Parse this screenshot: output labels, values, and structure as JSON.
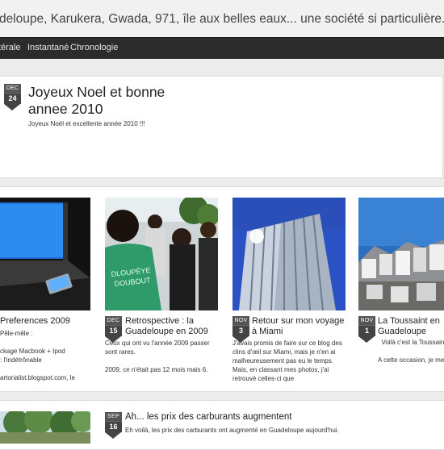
{
  "header": {
    "title": "deloupe, Karukera, Gwada, 971, île aux belles eaux... une société si particulière..."
  },
  "nav": [
    "térale",
    "Instantané",
    "Chronologie"
  ],
  "main_post": {
    "month": "DEC",
    "day": "24",
    "title": "Joyeux Noel et bonne annee 2010",
    "text": "Joyeux Noël et excellente année 2010 !!!"
  },
  "cards": [
    {
      "title": "Preferences 2009",
      "text": "Pêle-mêle :\n\nckage Macbook + Ipod\n: l'indétrônable\n\nartorialist.blogspot.com, le"
    },
    {
      "month": "DEC",
      "day": "15",
      "title": "Retrospective : la Guadeloupe en 2009",
      "text": "Ceux qui ont vu l'année 2009 passer sont rares.\n\n2009, ce n'était pas 12 mois mais 6."
    },
    {
      "month": "NOV",
      "day": "3",
      "title": "Retour sur mon voyage à Miami",
      "text": "J'avais promis de faire sur ce blog des clins d'œil sur Miami, mais je n'en ai malheureusement pas eu le temps. Mais, en classant mes photos, j'ai retrouvé celles-ci que"
    },
    {
      "month": "NOV",
      "day": "1",
      "title": "La Toussaint en Guadeloupe",
      "text": "Voilà c'est la Toussaint\n\nA cette occasion, je me suis dit que j'allais recommencer à bloguer, parce que c'est maintenant"
    }
  ],
  "bottom_post": {
    "month": "SEP",
    "day": "16",
    "title": "Ah... les prix des carburants augmentent",
    "text": "Eh voilà, les prix des carburants ont augmenté en Guadeloupe aujourd'hui."
  },
  "thumb_icons": [
    "laptop-photo",
    "crowd-photo",
    "building-photo",
    "cemetery-photo",
    "tree-photo"
  ]
}
